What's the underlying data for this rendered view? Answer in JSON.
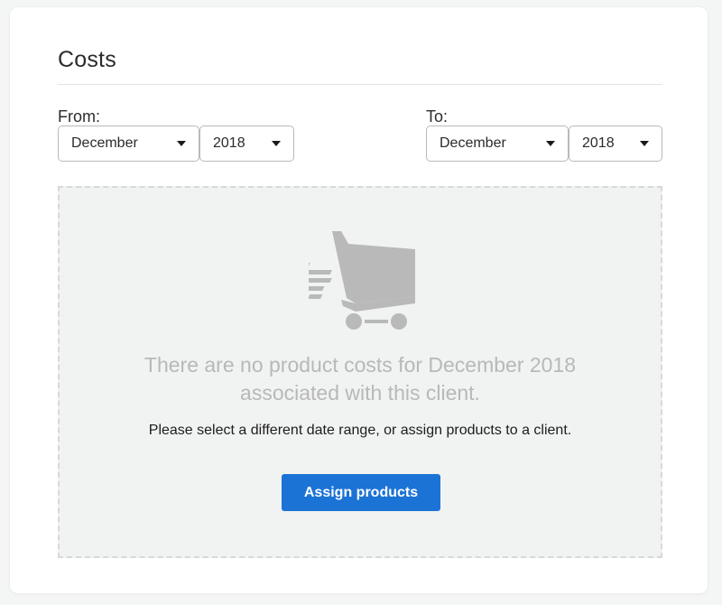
{
  "card": {
    "title": "Costs",
    "from": {
      "label": "From:",
      "month": "December",
      "year": "2018"
    },
    "to": {
      "label": "To:",
      "month": "December",
      "year": "2018"
    }
  },
  "empty_state": {
    "icon": "shopping-cart-icon",
    "message_line1": "There are no product costs for December 2018",
    "message_line2": "associated with this client.",
    "hint": "Please select a different date range, or assign products to a client.",
    "button_label": "Assign products"
  },
  "colors": {
    "accent": "#1b73d6",
    "empty_bg": "#f1f2f2",
    "muted_text": "#b8b8b8",
    "icon": "#b9b9b9"
  }
}
